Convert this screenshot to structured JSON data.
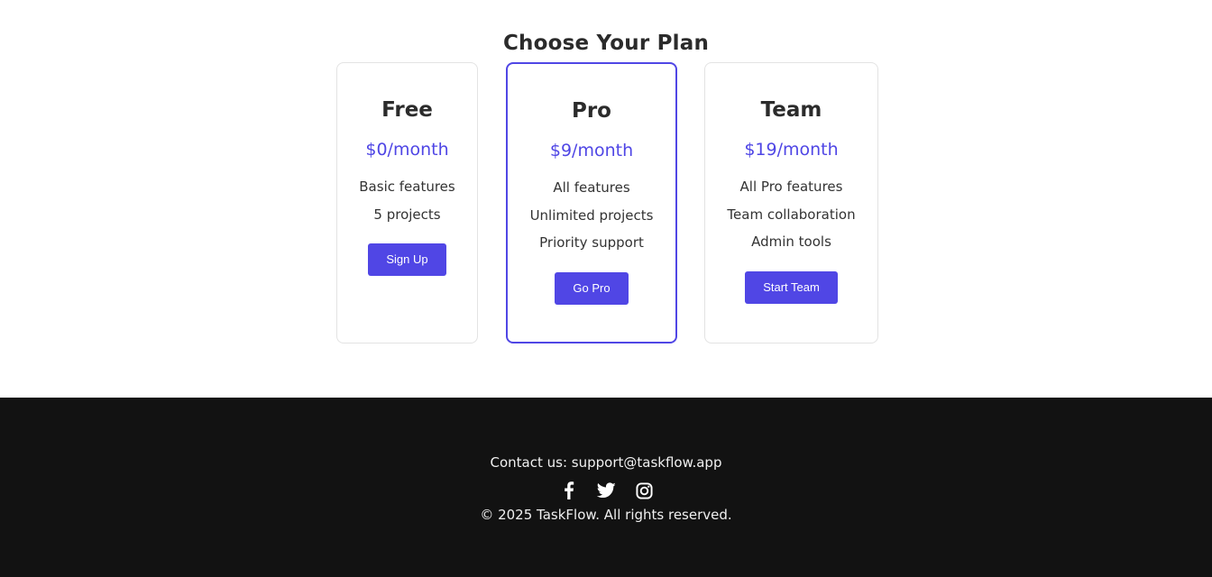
{
  "pricing": {
    "title": "Choose Your Plan",
    "plans": [
      {
        "name": "Free",
        "price": "$0/month",
        "features": [
          "Basic features",
          "5 projects"
        ],
        "cta": "Sign Up"
      },
      {
        "name": "Pro",
        "price": "$9/month",
        "features": [
          "All features",
          "Unlimited projects",
          "Priority support"
        ],
        "cta": "Go Pro"
      },
      {
        "name": "Team",
        "price": "$19/month",
        "features": [
          "All Pro features",
          "Team collaboration",
          "Admin tools"
        ],
        "cta": "Start Team"
      }
    ]
  },
  "footer": {
    "contact": "Contact us: support@taskflow.app",
    "socials": [
      "facebook-icon",
      "twitter-icon",
      "instagram-icon"
    ],
    "copyright": "© 2025 TaskFlow. All rights reserved."
  },
  "colors": {
    "accent": "#5046e5",
    "footer_bg": "#121212",
    "card_border": "#e3e3e3"
  }
}
